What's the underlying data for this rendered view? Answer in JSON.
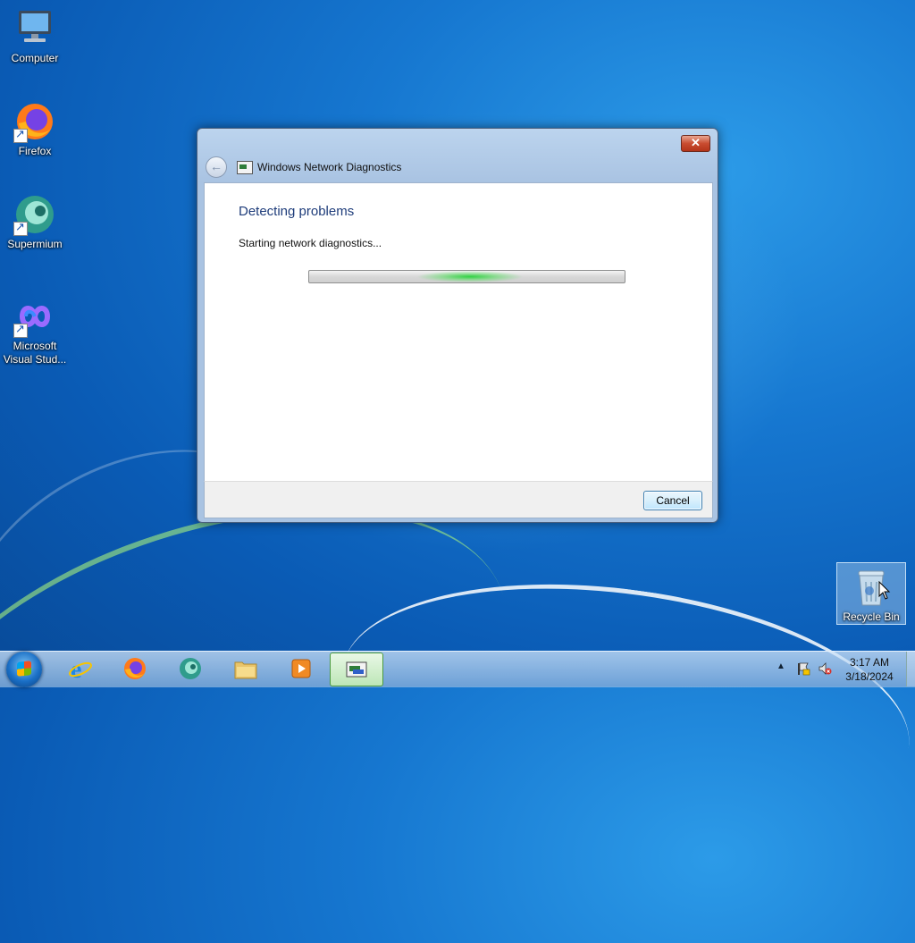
{
  "desktop": {
    "icons": [
      {
        "label": "Computer",
        "icon": "computer-icon"
      },
      {
        "label": "Firefox",
        "icon": "firefox-icon"
      },
      {
        "label": "Supermium",
        "icon": "supermium-icon"
      },
      {
        "label": "Microsoft Visual Stud...",
        "icon": "visual-studio-icon"
      },
      {
        "label": "Recycle Bin",
        "icon": "recycle-bin-icon"
      }
    ]
  },
  "dialog": {
    "title": "Windows Network Diagnostics",
    "close_symbol": "✕",
    "back_symbol": "←",
    "heading": "Detecting problems",
    "status": "Starting network diagnostics...",
    "progress": "indeterminate",
    "cancel_label": "Cancel"
  },
  "taskbar": {
    "items": [
      {
        "name": "internet-explorer",
        "icon": "internet-explorer-icon",
        "active": false
      },
      {
        "name": "firefox",
        "icon": "firefox-icon",
        "active": false
      },
      {
        "name": "supermium",
        "icon": "supermium-icon",
        "active": false
      },
      {
        "name": "file-explorer",
        "icon": "folder-icon",
        "active": false
      },
      {
        "name": "media-player",
        "icon": "media-player-icon",
        "active": false
      },
      {
        "name": "network-diagnostics",
        "icon": "network-diagnostics-icon",
        "active": true
      }
    ],
    "tray": {
      "show_hidden_symbol": "▲",
      "time": "3:17 AM",
      "date": "3/18/2024"
    }
  },
  "colors": {
    "heading": "#1e3c7a",
    "progress_glow": "#28d23c",
    "close_button": "#c94c30",
    "desktop": "#1677d0"
  }
}
